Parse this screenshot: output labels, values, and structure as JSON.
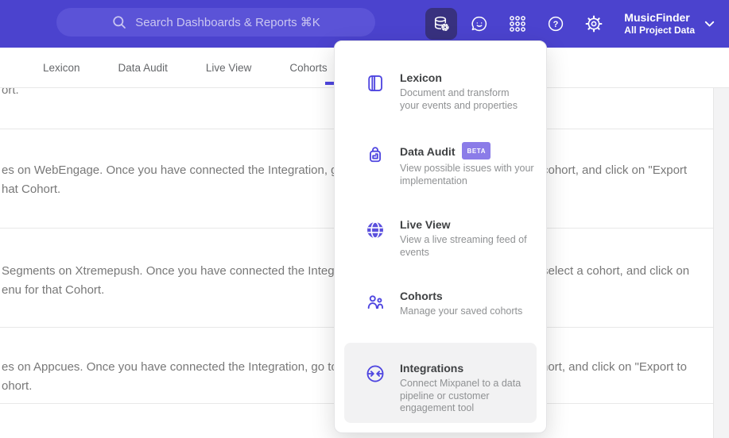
{
  "colors": {
    "header_bg": "#4b43ce",
    "search_bg": "#5b53d7",
    "active_button_bg": "#38317f",
    "accent_purple": "#4f46e0",
    "beta_badge_bg": "#8b7ce8",
    "highlight_row_bg": "#f2f2f3"
  },
  "header": {
    "search_placeholder": "Search Dashboards & Reports ⌘K",
    "project_name": "MusicFinder",
    "project_subtitle": "All Project Data",
    "icons": [
      "data-management-icon",
      "feedback-chat-icon",
      "apps-grid-icon",
      "help-icon",
      "settings-gear-icon",
      "chevron-down-icon"
    ]
  },
  "tabs": [
    {
      "label": "Lexicon"
    },
    {
      "label": "Data Audit"
    },
    {
      "label": "Live View"
    },
    {
      "label": "Cohorts"
    }
  ],
  "menu_items": [
    {
      "title": "Lexicon",
      "icon": "book-icon",
      "desc": "Document and transform\nyour events and properties"
    },
    {
      "title": "Data Audit",
      "icon": "lock-audit-icon",
      "badge": "BETA",
      "desc": "View possible issues with your\nimplementation"
    },
    {
      "title": "Live View",
      "icon": "globe-icon",
      "desc": "View a live streaming feed of\nevents"
    },
    {
      "title": "Cohorts",
      "icon": "people-icon",
      "desc": "Manage your saved cohorts"
    },
    {
      "title": "Integrations",
      "icon": "sync-arrows-icon",
      "desc": "Connect Mixpanel to a data\npipeline or customer\nengagement tool",
      "highlighted": true
    }
  ],
  "background": {
    "row1": {
      "line1": "ort."
    },
    "row2": {
      "line1_left": "es on WebEngage. Once you have connected the Integration, go to the",
      "line1_right": "cohort, and click on \"Export",
      "line2": "hat Cohort."
    },
    "row3": {
      "line1_left": "Segments on Xtremepush. Once you have connected the Integration,",
      "line1_right": "select a cohort, and click on",
      "line2": "enu for that Cohort."
    },
    "row4": {
      "line1_left": "es on Appcues. Once you have connected the Integration, go to the M",
      "line1_right": "hort, and click on \"Export to",
      "line2": "ohort."
    }
  }
}
